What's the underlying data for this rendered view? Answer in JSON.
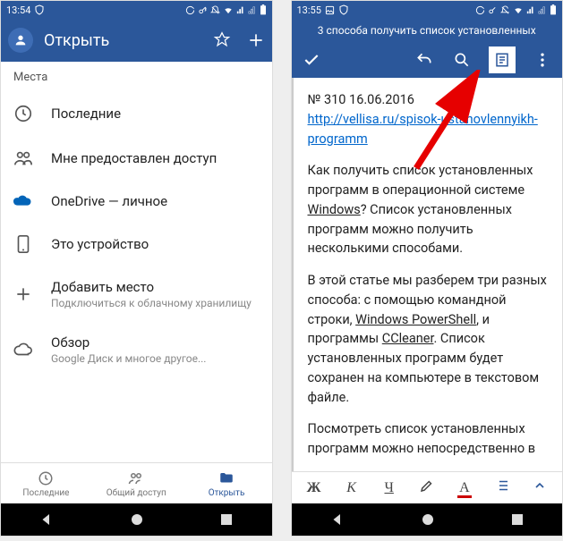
{
  "left": {
    "time": "13:54",
    "appbar_title": "Открыть",
    "section": "Места",
    "items": [
      {
        "label": "Последние",
        "sub": ""
      },
      {
        "label": "Мне предоставлен доступ",
        "sub": ""
      },
      {
        "label": "OneDrive — личное",
        "sub": ""
      },
      {
        "label": "Это устройство",
        "sub": ""
      },
      {
        "label": "Добавить место",
        "sub": "Подключиться к облачному хранилищу"
      },
      {
        "label": "Обзор",
        "sub": "Google Диск и многое другое..."
      }
    ],
    "tabs": [
      {
        "label": "Последние"
      },
      {
        "label": "Общий доступ"
      },
      {
        "label": "Открыть"
      }
    ]
  },
  "right": {
    "time": "13:55",
    "title": "3 способа получить список установленных",
    "doc": {
      "line1": "№ 310 16.06.2016",
      "link": "http://vellisa.ru/spisok-ustanovlennyikh-programm",
      "p1_a": "Как получить список установленных программ в операционной системе ",
      "p1_win": "Windows",
      "p1_b": "? Список установленных программ можно получить несколькими способами.",
      "p2_a": "В этой статье мы разберем три разных способа: с помощью командной строки, ",
      "p2_ps": "Windows PowerShell",
      "p2_b": ", и программы ",
      "p2_cc": "CCleaner",
      "p2_c": ". Список установленных программ будет сохранен на компьютере в текстовом файле.",
      "p3": "Посмотреть список установленных программ можно непосредственно в"
    },
    "fmt": {
      "b": "Ж",
      "i": "К",
      "u": "Ч"
    }
  }
}
